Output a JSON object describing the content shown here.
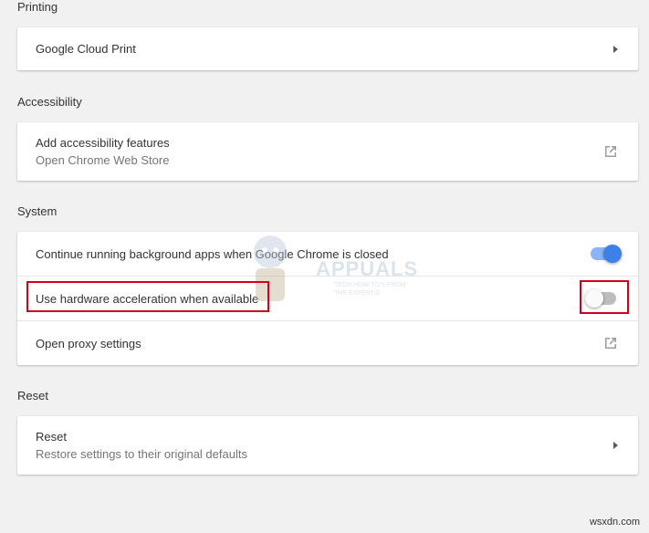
{
  "sections": {
    "printing": {
      "title": "Printing",
      "items": [
        {
          "label": "Google Cloud Print",
          "action": "chevron-right-icon"
        }
      ]
    },
    "accessibility": {
      "title": "Accessibility",
      "items": [
        {
          "label": "Add accessibility features",
          "sublabel": "Open Chrome Web Store",
          "action": "open-in-new-icon"
        }
      ]
    },
    "system": {
      "title": "System",
      "items": [
        {
          "label": "Continue running background apps when Google Chrome is closed",
          "toggle": "on"
        },
        {
          "label": "Use hardware acceleration when available",
          "toggle": "off"
        },
        {
          "label": "Open proxy settings",
          "action": "open-in-new-icon"
        }
      ]
    },
    "reset": {
      "title": "Reset",
      "items": [
        {
          "label": "Reset",
          "sublabel": "Restore settings to their original defaults",
          "action": "chevron-right-icon"
        }
      ]
    }
  },
  "watermark": {
    "brand": "APPUALS",
    "tagline": "TECH HOW-TO'S FROM THE EXPERTS!"
  },
  "site_mark": "wsxdn.com",
  "colors": {
    "accent": "#3f80e8",
    "highlight": "#d0021b",
    "background": "#f1f1f1"
  }
}
